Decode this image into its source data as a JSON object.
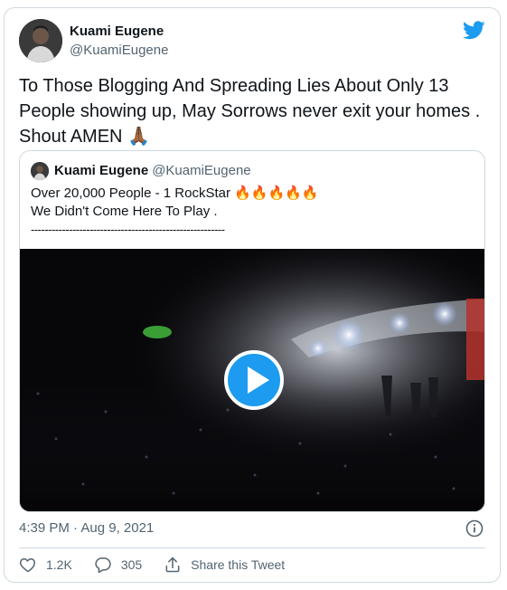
{
  "tweet": {
    "author": {
      "name": "Kuami Eugene",
      "handle": "@KuamiEugene"
    },
    "text_line1": "To Those Blogging And Spreading Lies About Only 13",
    "text_line2": "People showing up, May Sorrows never exit your homes .",
    "text_line3": "Shout AMEN 🙏🏾",
    "timestamp": "4:39 PM · Aug 9, 2021"
  },
  "quoted": {
    "name": "Kuami Eugene",
    "handle": "@KuamiEugene",
    "line1": "Over 20,000 People - 1 RockStar 🔥🔥🔥🔥🔥",
    "line2": "We Didn't Come Here To Play .",
    "line3": "----------------------------------------------------------"
  },
  "actions": {
    "likes": "1.2K",
    "replies": "305",
    "share_label": "Share this Tweet"
  },
  "icons": {
    "brand": "twitter-bird-icon",
    "like": "heart-icon",
    "reply": "comment-icon",
    "share": "share-icon",
    "info": "info-icon",
    "play": "play-icon"
  },
  "colors": {
    "accent": "#1d9bf0",
    "text": "#0f1419",
    "muted": "#536471",
    "border": "#cfd9de"
  }
}
